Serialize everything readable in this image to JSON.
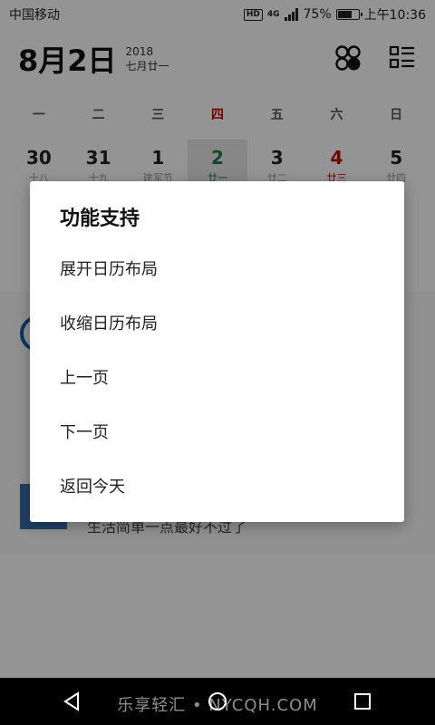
{
  "status_bar": {
    "carrier": "中国移动",
    "hd": "HD",
    "network": "4G",
    "battery_percent": "75%",
    "battery_level": 0.75,
    "time": "上午10:36"
  },
  "header": {
    "date": "8月2日",
    "year": "2018",
    "lunar_date": "七月廿一",
    "icons": [
      "clover-grid-icon",
      "list-view-icon"
    ]
  },
  "weekdays": [
    "一",
    "二",
    "三",
    "四",
    "五",
    "六",
    "日"
  ],
  "days": [
    {
      "num": "30",
      "lunar": "十八"
    },
    {
      "num": "31",
      "lunar": "十九"
    },
    {
      "num": "1",
      "lunar": "建军节"
    },
    {
      "num": "2",
      "lunar": "廿一"
    },
    {
      "num": "3",
      "lunar": "廿二"
    },
    {
      "num": "4",
      "lunar": "廿三"
    },
    {
      "num": "5",
      "lunar": "廿四"
    }
  ],
  "feed": {
    "text": "生活简单一点最好不过了"
  },
  "dialog": {
    "title": "功能支持",
    "items": [
      "展开日历布局",
      "收缩日历布局",
      "上一页",
      "下一页",
      "返回今天"
    ]
  },
  "nav": {
    "icons": [
      "back-icon",
      "home-icon",
      "recents-icon"
    ]
  },
  "watermark": "乐享轻汇 • NYCQH.COM",
  "colors": {
    "accent_green": "#1f7a4c",
    "accent_red": "#c00000"
  }
}
